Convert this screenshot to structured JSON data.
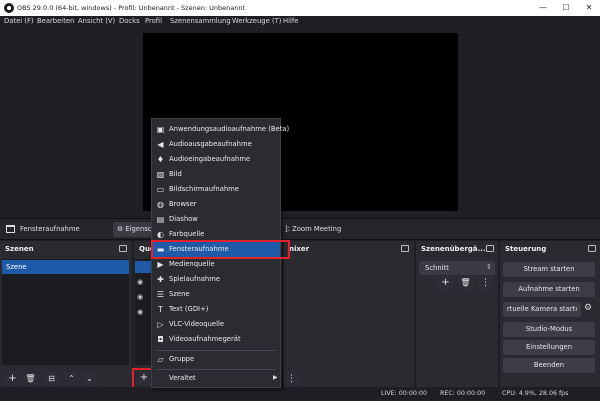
{
  "window": {
    "title": "OBS 29.0.0 (64-bit, windows) - Profil: Unbenannt - Szenen: Unbenannt",
    "minimize": "—",
    "maximize": "☐",
    "close": "✕"
  },
  "menu": [
    "Datei (F)",
    "Bearbeiten",
    "Ansicht (V)",
    "Docks",
    "Profil",
    "Szenensammlung",
    "Werkzeuge (T)",
    "Hilfe"
  ],
  "source_toolbar": {
    "source_name": "Fensteraufnahme",
    "properties_label": "Eigenscha",
    "window_value": "]: Zoom Meeting"
  },
  "docks": {
    "scenes": {
      "title": "Szenen",
      "items": [
        "Szene"
      ]
    },
    "sources": {
      "title": "Que"
    },
    "mixer": {
      "title": "nixer"
    },
    "transitions": {
      "title": "Szenenübergä...",
      "selected": "Schnitt"
    },
    "controls": {
      "title": "Steuerung",
      "buttons": [
        "Stream starten",
        "Aufnahme starten",
        "rtuelle Kamera startı",
        "Studio-Modus",
        "Einstellungen",
        "Beenden"
      ]
    }
  },
  "popup_menu": {
    "items": [
      {
        "label": "Anwendungsaudioaufnahme (Beta)",
        "icon": "app-audio-icon"
      },
      {
        "label": "Audioausgabeaufnahme",
        "icon": "speaker-icon"
      },
      {
        "label": "Audioeingabeaufnahme",
        "icon": "microphone-icon"
      },
      {
        "label": "Bild",
        "icon": "image-icon"
      },
      {
        "label": "Bildschirmaufnahme",
        "icon": "monitor-icon"
      },
      {
        "label": "Browser",
        "icon": "globe-icon"
      },
      {
        "label": "Diashow",
        "icon": "slideshow-icon"
      },
      {
        "label": "Farbquelle",
        "icon": "palette-icon"
      },
      {
        "label": "Fensteraufnahme",
        "icon": "window-icon"
      },
      {
        "label": "Medienquelle",
        "icon": "play-icon"
      },
      {
        "label": "Spielaufnahme",
        "icon": "gamepad-icon"
      },
      {
        "label": "Szene",
        "icon": "list-icon"
      },
      {
        "label": "Text (GDI+)",
        "icon": "text-icon"
      },
      {
        "label": "VLC-Videoquelle",
        "icon": "vlc-play-icon"
      },
      {
        "label": "Videoaufnahmegerät",
        "icon": "camera-icon"
      },
      {
        "label": "Gruppe",
        "icon": "folder-icon"
      },
      {
        "label": "Veraltet",
        "icon": ""
      }
    ],
    "selected": "Fensteraufnahme"
  },
  "status": {
    "live": "LIVE: 00:00:00",
    "rec": "REC: 00:00:00",
    "cpu": "CPU: 4.9%, 28.06 fps"
  }
}
